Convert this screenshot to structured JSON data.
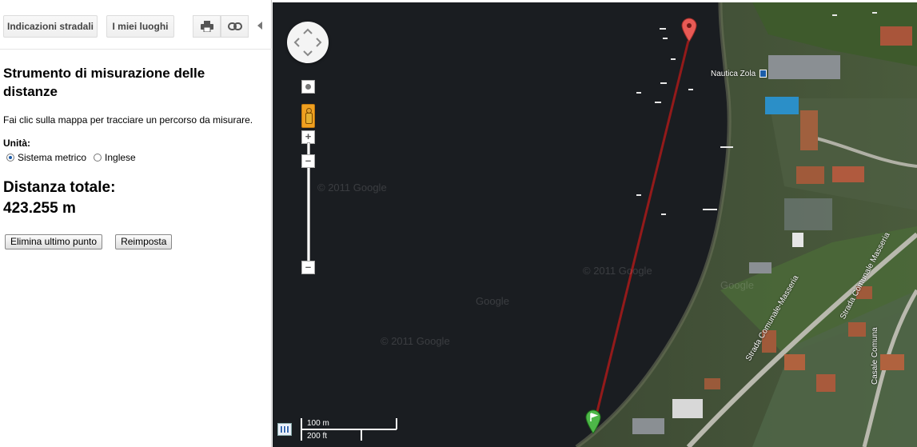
{
  "toolbar": {
    "directions_label": "Indicazioni stradali",
    "my_places_label": "I miei luoghi",
    "print_icon": "print-icon",
    "link_icon": "link-icon"
  },
  "panel": {
    "title": "Strumento di misurazione delle distanze",
    "description": "Fai clic sulla mappa per tracciare un percorso da misurare.",
    "units_label": "Unità:",
    "unit_metric": "Sistema metrico",
    "unit_imperial": "Inglese",
    "selected_unit": "Sistema metrico",
    "total_label": "Distanza totale:",
    "total_value": "423.255 m",
    "delete_last_label": "Elimina ultimo punto",
    "reset_label": "Reimposta"
  },
  "map": {
    "place_label": "Nautica Zola",
    "road_label_1": "Strada Comunale-Masseria",
    "road_label_2": "Strada Comunale Masseria",
    "road_label_3": "Casale Comuna",
    "watermarks": [
      "© 2011 Google",
      "© 2011 Google",
      "© 2011 Google",
      "Google",
      "Google"
    ],
    "scale_metric": "100 m",
    "scale_imperial": "200 ft",
    "route_color": "#a11a1a",
    "start_marker_color": "#4db748",
    "end_marker_color": "#e85a55"
  }
}
